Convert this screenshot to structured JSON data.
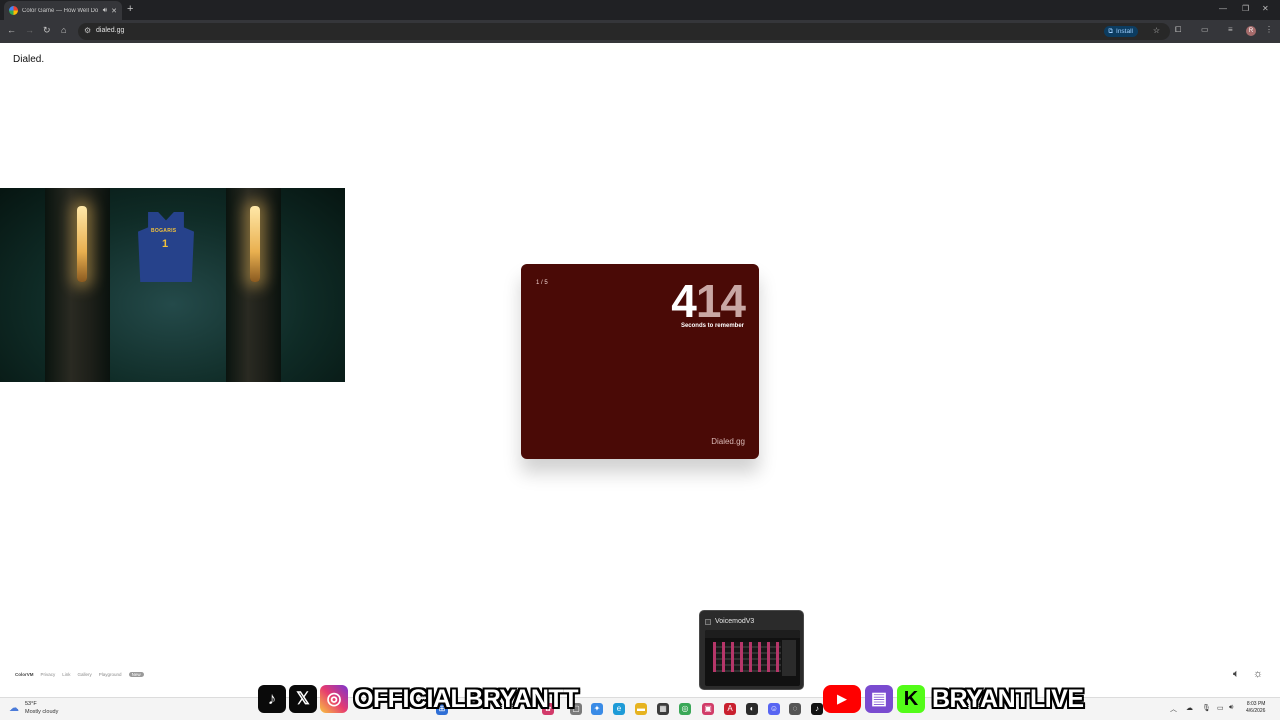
{
  "browser": {
    "tab_title": "Color Game — How Well Do",
    "tab_audio_icon": "speaker-icon",
    "new_tab_glyph": "+",
    "url": "dialed.gg",
    "install_label": "Install",
    "avatar_letter": "R"
  },
  "page": {
    "brand": "Dialed.",
    "card": {
      "round": "1 / 5",
      "timer_main": "4",
      "timer_dim": "14",
      "timer_caption": "Seconds to remember",
      "footer": "Dialed.gg",
      "background": "#4a0a06"
    },
    "webcam": {
      "jersey_name": "BOGARIS",
      "jersey_number": "1"
    },
    "footer_links": [
      "ColorVM",
      "Privacy",
      "Link",
      "Gallery",
      "Playground"
    ],
    "footer_badge": "New"
  },
  "voicemod_preview": {
    "title": "VoicemodV3"
  },
  "taskbar": {
    "weather_temp": "53°F",
    "weather_condition": "Mostly cloudy",
    "time": "8:03 PM",
    "date": "4/6/2026"
  },
  "stream_overlay": {
    "handle_left": "OFFICIALBRYANTT",
    "handle_right": "BRYANTLIVE"
  }
}
